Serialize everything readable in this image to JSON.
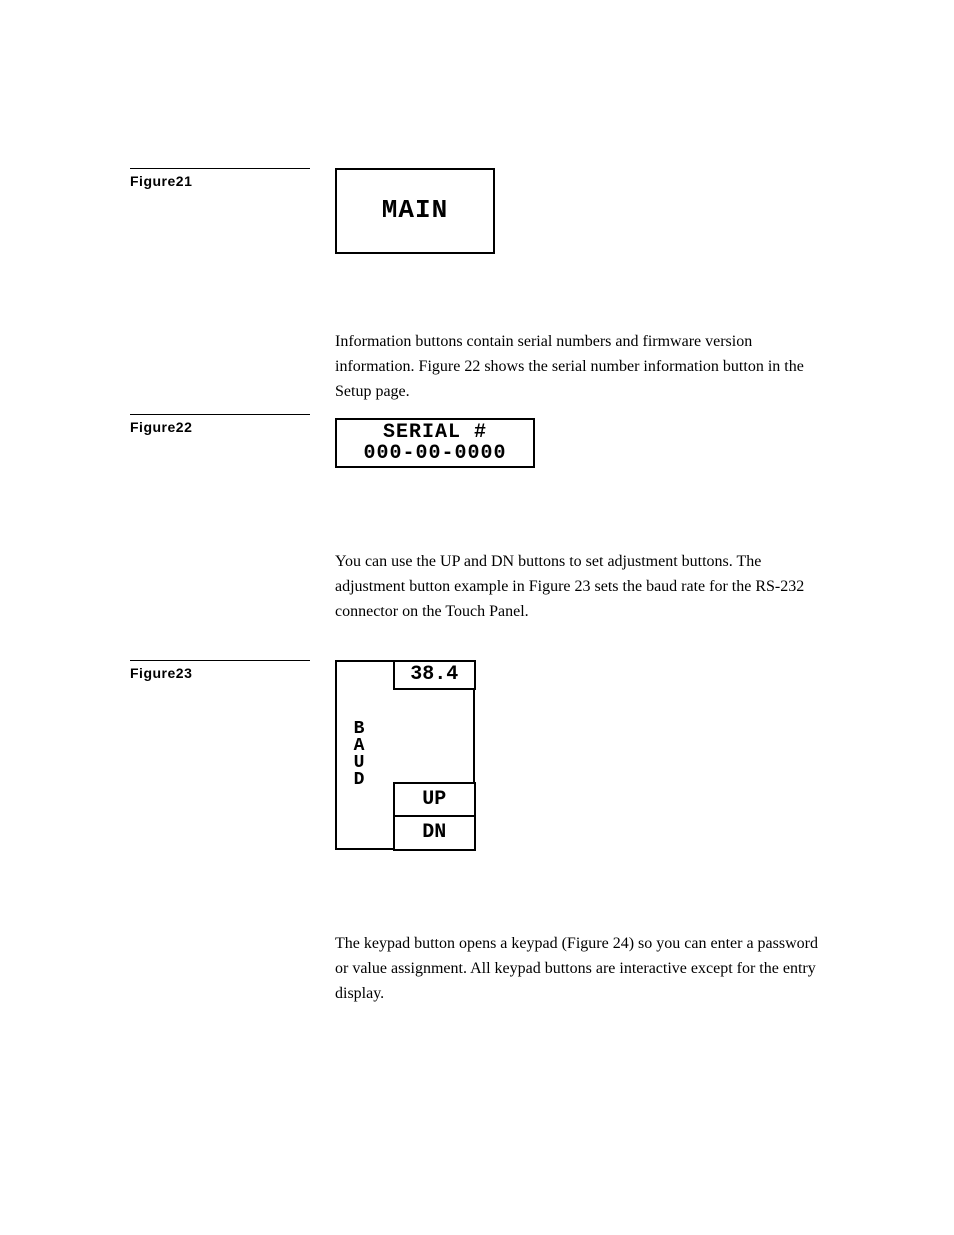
{
  "figures": {
    "f21": {
      "label": "Figure21",
      "display": "MAIN"
    },
    "f22": {
      "label": "Figure22",
      "display_line1": "SERIAL #",
      "display_line2": "000-00-0000"
    },
    "f23": {
      "label": "Figure23",
      "baud_label": "B\nA\nU\nD",
      "value": "38.4",
      "up": "UP",
      "dn": "DN"
    }
  },
  "paragraphs": {
    "p1": "Information buttons contain serial numbers and firmware version information. Figure 22 shows the serial number information button in the Setup page.",
    "p2": "You can use the UP and DN buttons to set adjustment buttons. The adjustment button example in Figure 23 sets the baud rate for the RS-232 connector on the Touch Panel.",
    "p3": "The keypad button opens a keypad (Figure 24) so you can enter a password or value assignment. All keypad buttons are interactive except for the entry display."
  }
}
